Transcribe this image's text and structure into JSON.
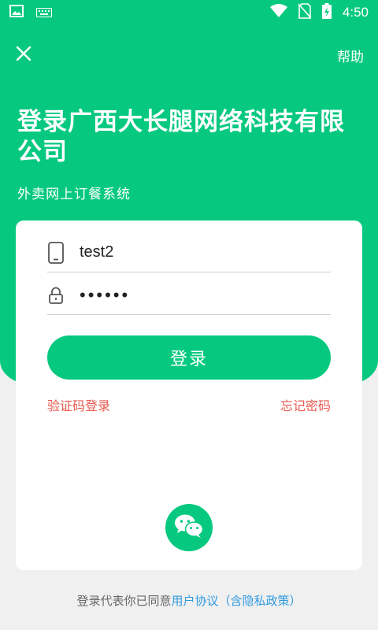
{
  "status_bar": {
    "time": "4:50",
    "icons": [
      "image-icon",
      "keyboard-icon",
      "wifi-icon",
      "no-sim-icon",
      "battery-charging-icon"
    ]
  },
  "header": {
    "close_icon": "close-icon",
    "help_label": "帮助"
  },
  "title": "登录广西大长腿网络科技有限公司",
  "subtitle": "外卖网上订餐系统",
  "form": {
    "username_value": "test2",
    "password_display": "••••••",
    "login_button": "登录",
    "sms_login_link": "验证码登录",
    "forgot_password_link": "忘记密码"
  },
  "wechat_icon": "wechat-icon",
  "agreement": {
    "prefix": "登录代表你已同意",
    "user_agreement": "用户协议",
    "privacy_policy": "（含隐私政策）"
  },
  "colors": {
    "primary": "#06c97f",
    "link_red": "#e85a4f",
    "link_blue": "#2f9be0"
  }
}
